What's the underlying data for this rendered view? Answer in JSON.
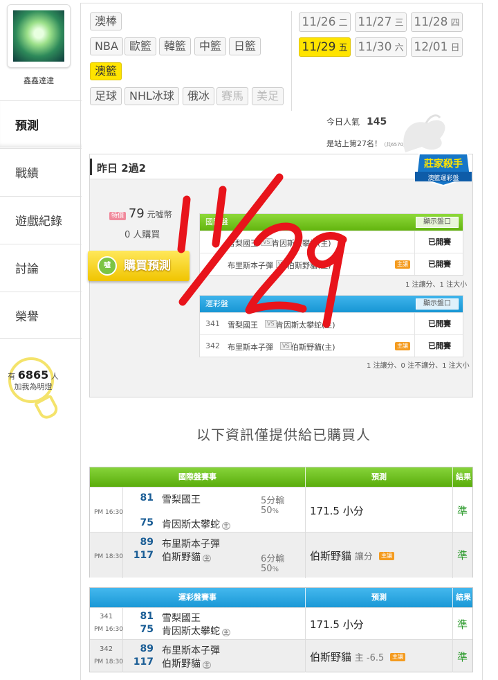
{
  "user": {
    "name": "鑫鑫達達"
  },
  "sidebar": {
    "items": [
      {
        "label": "預測"
      },
      {
        "label": "戰績"
      },
      {
        "label": "遊戲紀錄"
      },
      {
        "label": "討論"
      },
      {
        "label": "榮譽"
      }
    ],
    "followers": {
      "prefix": "有",
      "count": "6865",
      "suffix": "人",
      "text": "加我為明燈"
    }
  },
  "sports": {
    "row1": [
      "澳棒"
    ],
    "row2": [
      "NBA",
      "歐籃",
      "韓籃",
      "中籃",
      "日籃"
    ],
    "row3": [
      "澳籃"
    ],
    "row4": [
      "足球",
      "NHL冰球",
      "俄冰",
      "賽馬",
      "美足"
    ],
    "active": "澳籃"
  },
  "dates": [
    {
      "md": "11/26",
      "dow": "二"
    },
    {
      "md": "11/27",
      "dow": "三"
    },
    {
      "md": "11/28",
      "dow": "四"
    },
    {
      "md": "11/29",
      "dow": "五"
    },
    {
      "md": "11/30",
      "dow": "六"
    },
    {
      "md": "12/01",
      "dow": "日"
    }
  ],
  "active_date": "11/29",
  "popularity": {
    "label": "今日人氣",
    "value": "145",
    "rank_text": "是站上第27名！",
    "rank_total": "(共6570人)"
  },
  "yesterday": {
    "title": "昨日 2過2",
    "badge_line1": "莊家殺手",
    "badge_line2": "澳籃運彩盤",
    "price_tag": "特價",
    "price": "79",
    "price_unit": "元噓幣",
    "buyers": "0 人購買",
    "buy_button": "購買預測",
    "buy_icon": "噓",
    "intl_header": "國際盤",
    "show_button": "顯示盤口",
    "sport_header": "運彩盤",
    "intl_rows": [
      {
        "t1": "雪梨國王",
        "vs": "VS",
        "t2": "肯因斯太攀蛇(主)",
        "status": "已開賽"
      },
      {
        "t1": "布里斯本子彈",
        "vs": "VS",
        "t2": "伯斯野貓(主)",
        "home": "主讓",
        "status": "已開賽"
      }
    ],
    "intl_note": "1 注讓分、1 注大小",
    "sport_rows": [
      {
        "no": "341",
        "t1": "雪梨國王",
        "vs": "VS",
        "t2": "肯因斯太攀蛇(主)",
        "status": "已開賽"
      },
      {
        "no": "342",
        "t1": "布里斯本子彈",
        "vs": "VS",
        "t2": "伯斯野貓(主)",
        "home": "主讓",
        "status": "已開賽"
      }
    ],
    "sport_note": "1 注讓分、0 注不讓分、1 注大小"
  },
  "info_title": "以下資訊僅提供給已購買人",
  "intl_table": {
    "headers": [
      "國際盤賽事",
      "預測",
      "結果"
    ],
    "rows": [
      {
        "time": "PM 16:30",
        "s1": "81",
        "t1": "雪梨國王",
        "s2": "75",
        "t2": "肯因斯太攀蛇",
        "home": "主",
        "hc": "5分輸",
        "hc_pct": "50",
        "hc_unit": "%",
        "pred": "171.5 小分",
        "result": "準"
      },
      {
        "time": "PM 18:30",
        "s1": "89",
        "t1": "布里斯本子彈",
        "s2": "117",
        "t2": "伯斯野貓",
        "home": "主",
        "hc": "6分輸",
        "hc_pct": "50",
        "hc_unit": "%",
        "pred": "伯斯野貓",
        "pred_sub": "讓分",
        "pred_tag": "主讓",
        "result": "準"
      }
    ]
  },
  "sport_table": {
    "headers": [
      "運彩盤賽事",
      "預測",
      "結果"
    ],
    "rows": [
      {
        "no": "341",
        "time": "PM 16:30",
        "s1": "81",
        "t1": "雪梨國王",
        "s2": "75",
        "t2": "肯因斯太攀蛇",
        "home": "主",
        "pred": "171.5 小分",
        "result": "準"
      },
      {
        "no": "342",
        "time": "PM 18:30",
        "s1": "89",
        "t1": "布里斯本子彈",
        "s2": "117",
        "t2": "伯斯野貓",
        "home": "主",
        "pred": "伯斯野貓",
        "pred_sub": "主 -6.5",
        "pred_tag": "主讓",
        "result": "準"
      }
    ]
  },
  "colors": {
    "accent_yellow": "#ffe400",
    "intl_green": "#62b40e",
    "sport_blue": "#1796d4",
    "result_green": "#2b9a2b",
    "score_blue": "#1a5d95",
    "scribble_red": "#e8141b"
  },
  "overlay": {
    "handwritten": "11/29"
  }
}
